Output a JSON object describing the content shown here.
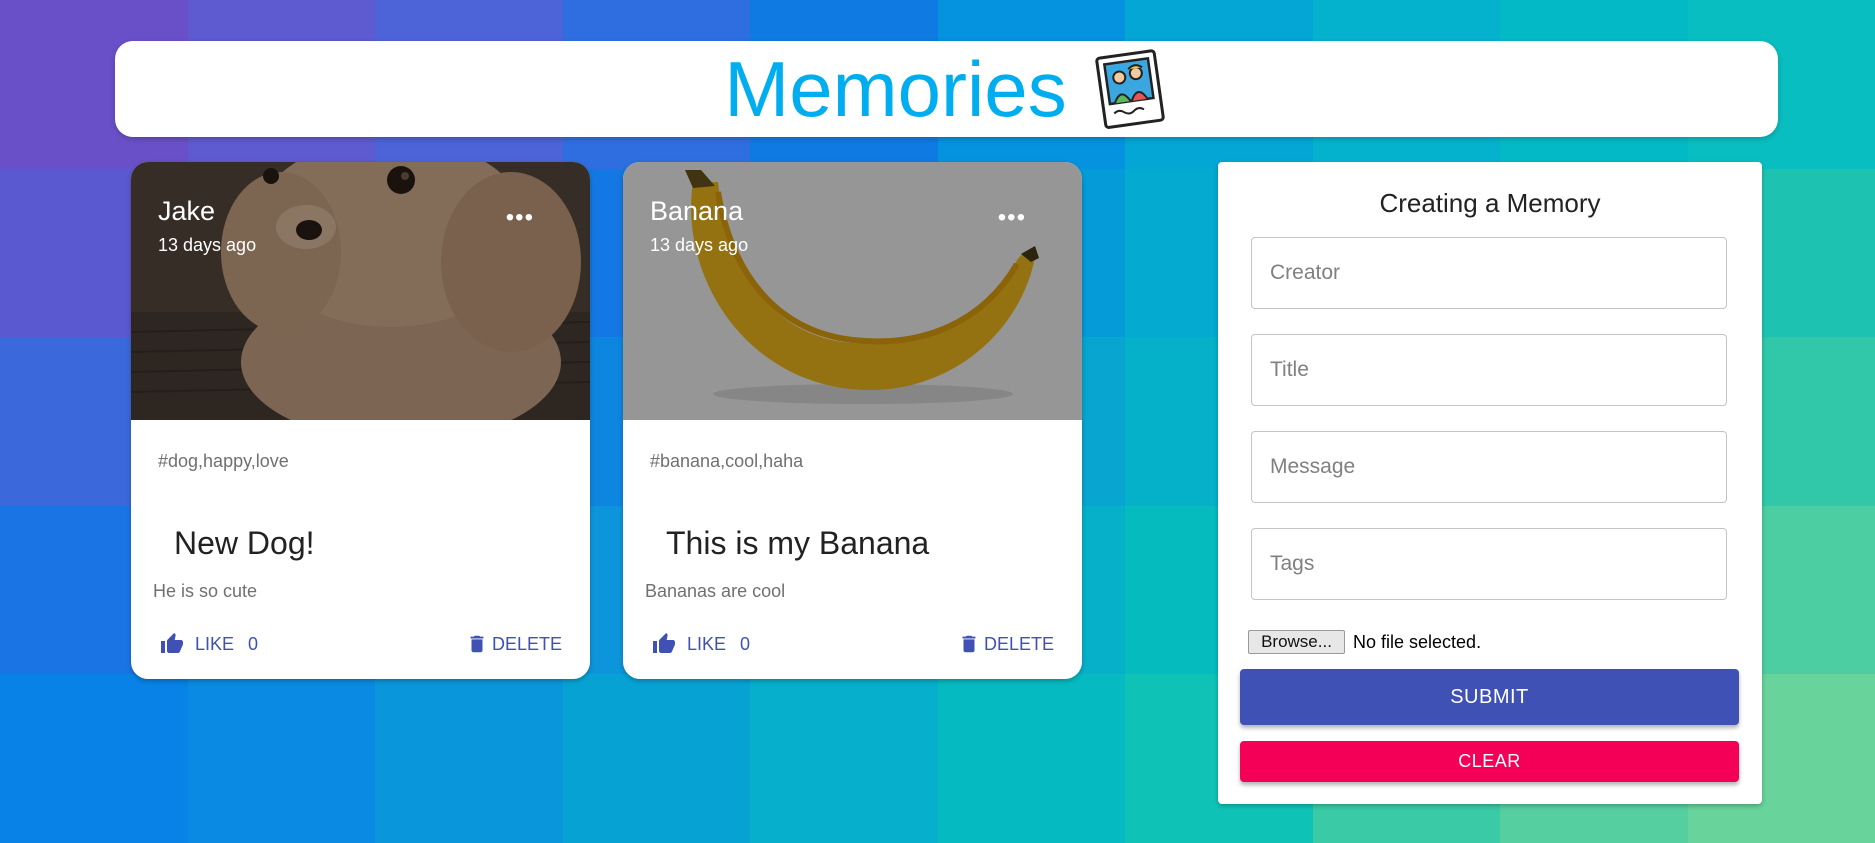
{
  "app": {
    "title": "Memories",
    "logo_icon": "photo-memories-icon"
  },
  "posts": [
    {
      "creator": "Jake",
      "time": "13 days ago",
      "more_icon": "more-horizontal-icon",
      "image": "poodle-dog-photo",
      "tags": "#dog,happy,love",
      "title": "New Dog!",
      "message": "He is so cute",
      "like_label": "LIKE",
      "like_count": "0",
      "delete_label": "DELETE"
    },
    {
      "creator": "Banana",
      "time": "13 days ago",
      "more_icon": "more-horizontal-icon",
      "image": "banana-photo",
      "tags": "#banana,cool,haha",
      "title": "This is my Banana",
      "message": "Bananas are cool",
      "like_label": "LIKE",
      "like_count": "0",
      "delete_label": "DELETE"
    }
  ],
  "form": {
    "title": "Creating a Memory",
    "creator_placeholder": "Creator",
    "title_placeholder": "Title",
    "message_placeholder": "Message",
    "tags_placeholder": "Tags",
    "browse_label": "Browse...",
    "file_status": "No file selected.",
    "submit_label": "SUBMIT",
    "clear_label": "CLEAR"
  },
  "colors": {
    "title": "#00aef0",
    "primary": "#3f51b5",
    "secondary": "#f50057",
    "background_from": "#6a50c8",
    "background_to": "#5dd3a0"
  }
}
